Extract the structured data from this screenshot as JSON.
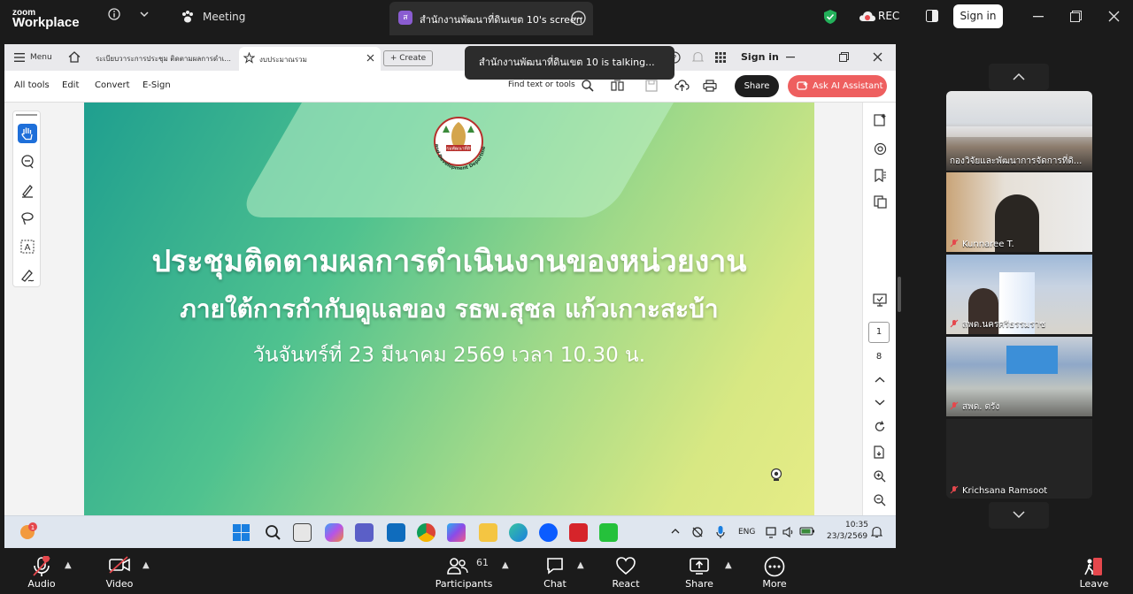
{
  "zoom": {
    "brand_small": "zoom",
    "brand_big": "Workplace",
    "meeting_label": "Meeting",
    "share_badge": "ส",
    "share_title": "สำนักงานพัฒนาที่ดินเขต 10's screen",
    "rec_label": "REC",
    "signin_label": "Sign in"
  },
  "browser": {
    "menu_label": "Menu",
    "tab1": "ระเบียบวาระการประชุม ติดตามผลการดำเ...",
    "tab2": "งบประมาณรวม",
    "create_label": "+ Create",
    "tools": [
      "All tools",
      "Edit",
      "Convert",
      "E-Sign"
    ],
    "find_label": "Find text or tools",
    "share_label": "Share",
    "ask_ai_label": "Ask AI Assistant",
    "signin_label": "Sign in",
    "talking_toast": "สำนักงานพัฒนาที่ดินเขต 10 is talking...",
    "page_current": "1",
    "page_total": "8"
  },
  "slide": {
    "logo_caption": "Land Development Department",
    "logo_text": "กรมพัฒนาที่ดิน",
    "title": "ประชุมติดตามผลการดำเนินงานของหน่วยงาน",
    "subtitle": "ภายใต้การกำกับดูแลของ รธพ.สุชล แก้วเกาะสะบ้า",
    "date_line": "วันจันทร์ที่ 23 มีนาคม 2569 เวลา 10.30 น."
  },
  "taskbar": {
    "notif_count": "1",
    "lang": "ENG",
    "time": "10:35",
    "date": "23/3/2569"
  },
  "participants": [
    {
      "name": "กองวิจัยและพัฒนาการจัดการที่ดิ..."
    },
    {
      "name": "Kunnaree T."
    },
    {
      "name": "สพด.นครศรีธรรมราช"
    },
    {
      "name": "สพด. ตรัง"
    },
    {
      "name": "Krichsana Ramsoot"
    }
  ],
  "bottombar": {
    "audio": "Audio",
    "video": "Video",
    "participants": "Participants",
    "participants_count": "61",
    "chat": "Chat",
    "react": "React",
    "share": "Share",
    "more": "More",
    "leave": "Leave"
  },
  "colors": {
    "zoom_bg": "#1b1b1b",
    "ask_ai": "#ee5f5f",
    "slide_start": "#1f9f8f",
    "slide_end": "#e6ec86",
    "muted_red": "#e5484d"
  }
}
